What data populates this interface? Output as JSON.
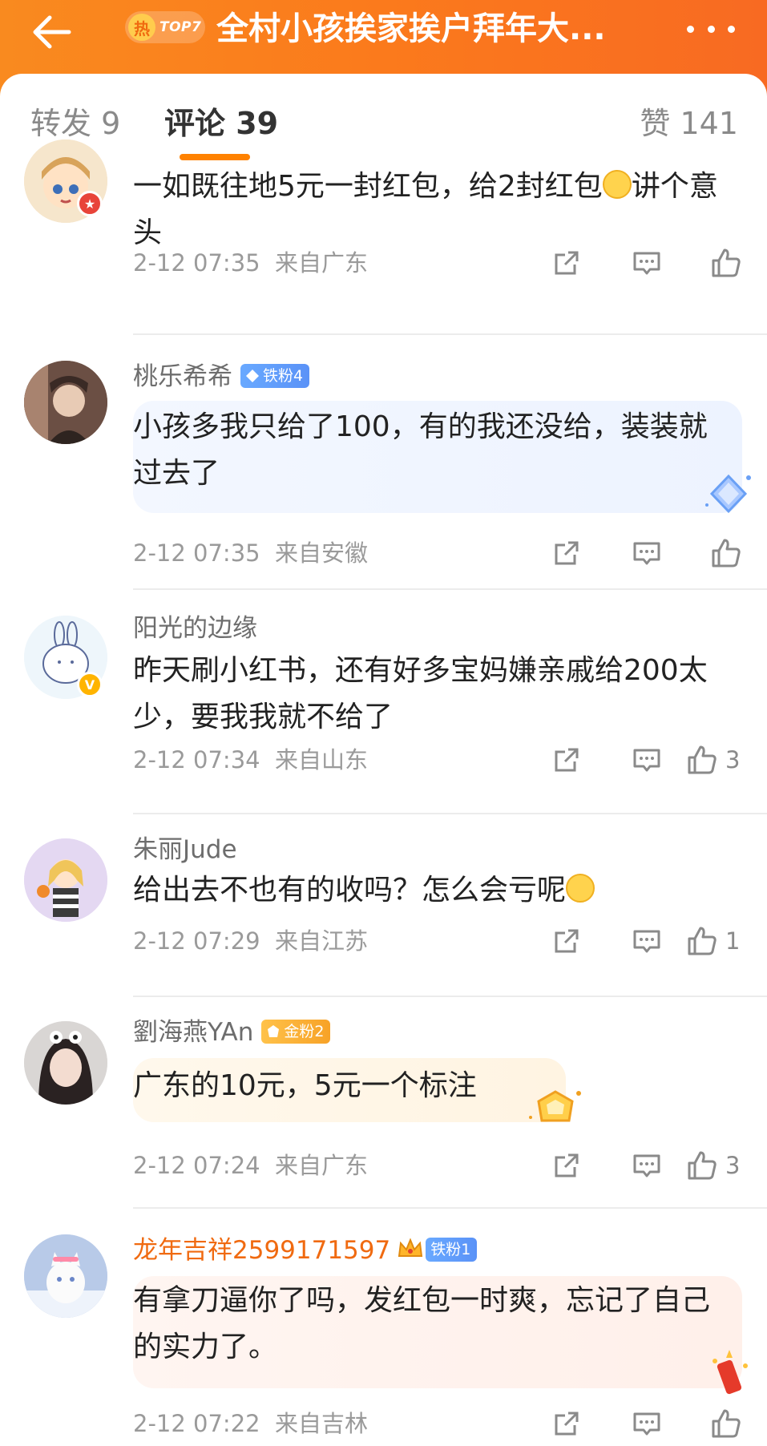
{
  "header": {
    "hot_char": "热",
    "hot_rank": "TOP7",
    "title": "全村小孩挨家挨户拜年大..."
  },
  "tabs": {
    "repost": "转发 9",
    "comments": "评论 39",
    "likes": "赞 141"
  },
  "colors": {
    "accent": "#ff8200",
    "header": "#fb7a1c"
  },
  "comments": [
    {
      "username": "",
      "text_a": "一如既往地5元一封红包，给2封红包",
      "text_b": "讲个意头",
      "emoji": "smile-emoji",
      "time": "2-12 07:35",
      "location": "来自广东",
      "likes": ""
    },
    {
      "username": "桃乐希希",
      "badge": "铁粉4",
      "text": "小孩多我只给了100，有的我还没给，装装就过去了",
      "time": "2-12 07:35",
      "location": "来自安徽",
      "likes": ""
    },
    {
      "username": "阳光的边缘",
      "text": "昨天刷小红书，还有好多宝妈嫌亲戚给200太少，要我我就不给了",
      "time": "2-12 07:34",
      "location": "来自山东",
      "likes": "3"
    },
    {
      "username": "朱丽Jude",
      "text": "给出去不也有的收吗？怎么会亏呢",
      "emoji": "laugh-cry-emoji",
      "time": "2-12 07:29",
      "location": "来自江苏",
      "likes": "1"
    },
    {
      "username": "劉海燕YAn",
      "badge": "金粉2",
      "text": "广东的10元，5元一个标注",
      "time": "2-12 07:24",
      "location": "来自广东",
      "likes": "3"
    },
    {
      "username": "龙年吉祥2599171597",
      "badge": "铁粉1",
      "text": "有拿刀逼你了吗，发红包一时爽，忘记了自己的实力了。",
      "time": "2-12 07:22",
      "location": "来自吉林",
      "likes": ""
    }
  ]
}
